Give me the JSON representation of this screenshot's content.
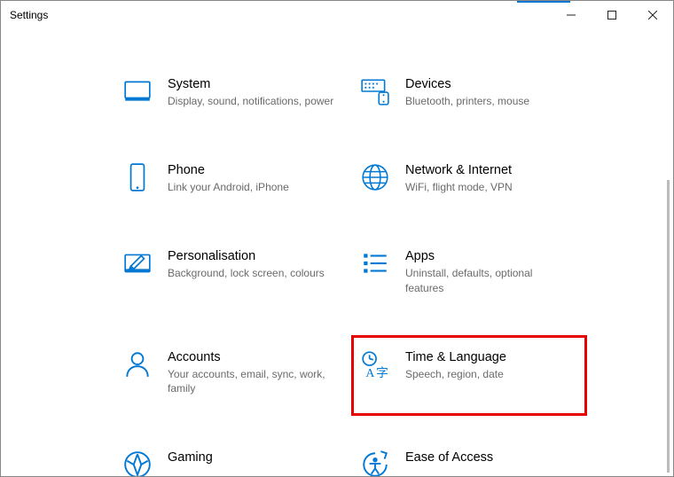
{
  "window": {
    "title": "Settings"
  },
  "categories": {
    "system": {
      "title": "System",
      "desc": "Display, sound, notifications, power"
    },
    "devices": {
      "title": "Devices",
      "desc": "Bluetooth, printers, mouse"
    },
    "phone": {
      "title": "Phone",
      "desc": "Link your Android, iPhone"
    },
    "network": {
      "title": "Network & Internet",
      "desc": "WiFi, flight mode, VPN"
    },
    "personalisation": {
      "title": "Personalisation",
      "desc": "Background, lock screen, colours"
    },
    "apps": {
      "title": "Apps",
      "desc": "Uninstall, defaults, optional features"
    },
    "accounts": {
      "title": "Accounts",
      "desc": "Your accounts, email, sync, work, family"
    },
    "time_language": {
      "title": "Time & Language",
      "desc": "Speech, region, date"
    },
    "gaming": {
      "title": "Gaming",
      "desc": ""
    },
    "ease_of_access": {
      "title": "Ease of Access",
      "desc": ""
    }
  },
  "highlighted": "time_language",
  "colors": {
    "accent": "#0078d4",
    "highlight_border": "#e40000"
  }
}
